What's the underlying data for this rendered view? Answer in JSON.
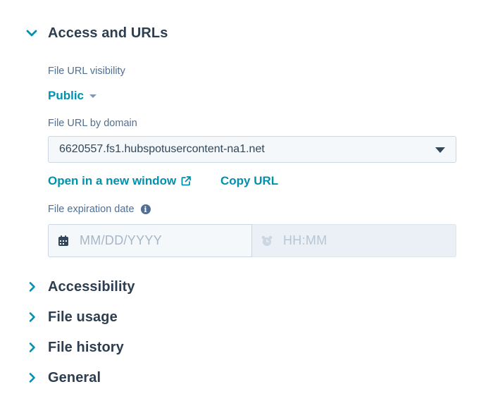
{
  "sections": {
    "access": {
      "title": "Access and URLs",
      "expanded": true,
      "visibility_label": "File URL visibility",
      "visibility_value": "Public",
      "domain_label": "File URL by domain",
      "domain_value": "6620557.fs1.hubspotusercontent-na1.net",
      "open_link": "Open in a new window",
      "copy_link": "Copy URL",
      "expiration_label": "File expiration date",
      "date_placeholder": "MM/DD/YYYY",
      "time_placeholder": "HH:MM"
    },
    "accessibility": {
      "title": "Accessibility",
      "expanded": false
    },
    "usage": {
      "title": "File usage",
      "expanded": false
    },
    "history": {
      "title": "File history",
      "expanded": false
    },
    "general": {
      "title": "General",
      "expanded": false
    }
  },
  "colors": {
    "accent": "#0091ae",
    "heading": "#2d3e50",
    "label": "#516f90",
    "input_bg": "#f5f8fa",
    "disabled_bg": "#eaf0f6",
    "border": "#cbd6e2"
  },
  "icons": {
    "expanded_chevron": "chevron-down-icon",
    "collapsed_chevron": "chevron-right-icon",
    "external": "external-link-icon",
    "info": "info-icon",
    "calendar": "calendar-icon",
    "clock": "alarm-clock-icon"
  }
}
